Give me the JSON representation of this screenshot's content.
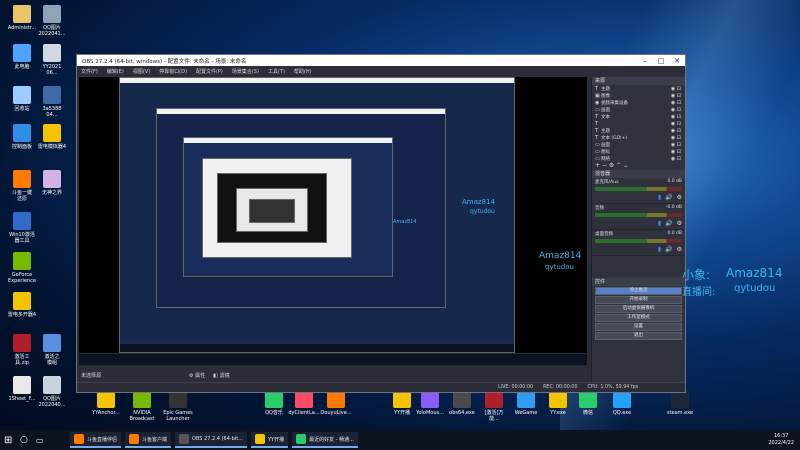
{
  "desktop_icons_top": [
    {
      "label": "Administr...",
      "x": 0
    },
    {
      "label": "QQ图片\n2022041...",
      "x": 1
    }
  ],
  "desktop_left": [
    {
      "label": "此电脑",
      "color": "#4da3ff"
    },
    {
      "label": "YY2021\n06...",
      "color": "#cfd8e3"
    },
    {
      "label": "回收站",
      "color": "#9ecbff"
    },
    {
      "label": "3a5388\n04...",
      "color": "#3e6aa6"
    },
    {
      "label": "控制面板",
      "color": "#2f8fe8"
    },
    {
      "label": "雷电模拟器4",
      "color": "#f5c400"
    },
    {
      "label": "斗鱼一键\n还原",
      "color": "#ff7a00"
    },
    {
      "label": "无神之界",
      "color": "#d4b2e8"
    },
    {
      "label": "Win10激活\n器工具",
      "color": "#2f6bc9"
    },
    {
      "label": "GeForce\nExperience",
      "color": "#76b900"
    },
    {
      "label": "雷电多开器4",
      "color": "#f5c400"
    },
    {
      "label": "激活工\n具.zip",
      "color": "#b01e2a"
    },
    {
      "label": "激活之\n模组",
      "color": "#5a8ee0"
    },
    {
      "label": "1Sheet_F...",
      "color": "#e8e8e8"
    },
    {
      "label": "QQ图片\n2022040...",
      "color": "#c9d3de"
    }
  ],
  "desktop_bottom": [
    {
      "label": "YYAnchor...",
      "color": "#f5c400"
    },
    {
      "label": "NVIDIA\nBroadcast",
      "color": "#76b900"
    },
    {
      "label": "Epic Games\nLauncher",
      "color": "#333333"
    },
    {
      "label": "QQ音乐",
      "color": "#2bcc6b"
    },
    {
      "label": "dyClientLa...",
      "color": "#ff4a64"
    },
    {
      "label": "DouyuLive...",
      "color": "#ff7a00"
    },
    {
      "label": "YY开播",
      "color": "#f5c400"
    },
    {
      "label": "YoloMous...",
      "color": "#8a5cf6"
    },
    {
      "label": "obs64.exe",
      "color": "#4a4a4a"
    },
    {
      "label": "[激活]万\n能...",
      "color": "#b01e2a"
    },
    {
      "label": "WeGame",
      "color": "#2e9cf0"
    },
    {
      "label": "YY.exe",
      "color": "#f5c400"
    },
    {
      "label": "微信",
      "color": "#2bcc6b"
    },
    {
      "label": "QQ.exe",
      "color": "#26a0ff"
    },
    {
      "label": "steam.exe",
      "color": "#1b2838"
    }
  ],
  "obs": {
    "title": "OBS 27.2.4 (64-bit, windows) - 配置文件: 未命名 - 场景: 未命名",
    "menu": [
      "文件(F)",
      "编辑(E)",
      "视图(V)",
      "停靠窗口(D)",
      "配置文件(P)",
      "场景集合(S)",
      "工具(T)",
      "帮助(H)"
    ],
    "sources_title": "来源",
    "sources": [
      {
        "icon": "T",
        "label": "主题"
      },
      {
        "icon": "▣",
        "label": "图像"
      },
      {
        "icon": "◉",
        "label": "视频采集设备"
      },
      {
        "icon": "▭",
        "label": "画面"
      },
      {
        "icon": "T",
        "label": "文本"
      },
      {
        "icon": "T",
        "label": ""
      },
      {
        "icon": "T",
        "label": "主题"
      },
      {
        "icon": "T",
        "label": "文本 (GDI+)"
      },
      {
        "icon": "▭",
        "label": "画面"
      },
      {
        "icon": "▭",
        "label": "图标"
      },
      {
        "icon": "▭",
        "label": "网络"
      }
    ],
    "mixer_title": "混音器",
    "mixer": [
      {
        "name": "麦克风/Aux",
        "db": "0.0 dB"
      },
      {
        "name": "音频",
        "db": "-0.0 dB"
      },
      {
        "name": "桌面音频",
        "db": "0.0 dB"
      }
    ],
    "controls_title": "控件",
    "controls": [
      "停止推流",
      "开始录制",
      "启动虚拟摄像机",
      "工作室模式",
      "设置",
      "退出"
    ],
    "scene_label": "未选择源",
    "scene_buttons": [
      "属性",
      "滤镜"
    ],
    "status": {
      "live": "LIVE: 00:00:00",
      "rec": "REC: 00:00:00",
      "cpu": "CPU: 1.0%, 59.94 fps"
    }
  },
  "overlay": {
    "line1": "Amaz814",
    "line2": "qytudou",
    "prefix1": "小象:",
    "prefix2": "直播间:"
  },
  "taskbar": {
    "apps": [
      {
        "label": "斗鱼直播伴侣",
        "color": "#ff7a00"
      },
      {
        "label": "斗鱼客户端",
        "color": "#ff7a00"
      },
      {
        "label": "OBS 27.2.4 (64-bit...",
        "color": "#555555"
      },
      {
        "label": "YY开播",
        "color": "#f5c400"
      },
      {
        "label": "最近的好友 - 畅通...",
        "color": "#2bcc6b"
      }
    ],
    "time": "16:37",
    "date": "2022/4/22"
  }
}
